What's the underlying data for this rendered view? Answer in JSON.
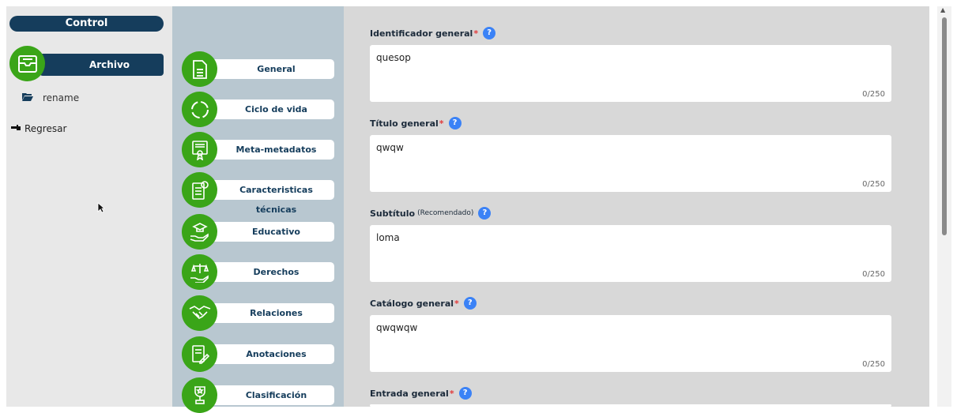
{
  "control": {
    "title": "Control",
    "archivo_label": "Archivo",
    "folder_item": "rename",
    "back_label": "Regresar"
  },
  "nav": {
    "items": [
      {
        "label": "General",
        "icon": "document-icon"
      },
      {
        "label": "Ciclo de vida",
        "icon": "cycle-icon"
      },
      {
        "label": "Meta-metadatos",
        "icon": "certificate-icon"
      },
      {
        "label": "Caracteristicas técnicas",
        "icon": "tech-doc-icon"
      },
      {
        "label": "Educativo",
        "icon": "graduation-hand-icon"
      },
      {
        "label": "Derechos",
        "icon": "scales-hand-icon"
      },
      {
        "label": "Relaciones",
        "icon": "handshake-icon"
      },
      {
        "label": "Anotaciones",
        "icon": "annotation-icon"
      },
      {
        "label": "Clasificación",
        "icon": "trophy-icon"
      }
    ]
  },
  "form": {
    "fields": [
      {
        "label": "Identificador general",
        "required": "*",
        "value": "quesop",
        "counter": "0/250"
      },
      {
        "label": "Título general",
        "required": "*",
        "value": "qwqw",
        "counter": "0/250"
      },
      {
        "label": "Subtítulo",
        "recommended": "(Recomendado)",
        "value": "loma",
        "counter": "0/250"
      },
      {
        "label": "Catálogo general",
        "required": "*",
        "value": "qwqwqw",
        "counter": "0/250"
      },
      {
        "label": "Entrada general",
        "required": "*",
        "value": "",
        "counter": ""
      }
    ],
    "help_glyph": "?"
  },
  "colors": {
    "brand_dark": "#153d5c",
    "brand_green": "#3aa518",
    "nav_bg": "#b8c7d0",
    "help_blue": "#3b82f6",
    "required_red": "#e23b3b"
  }
}
